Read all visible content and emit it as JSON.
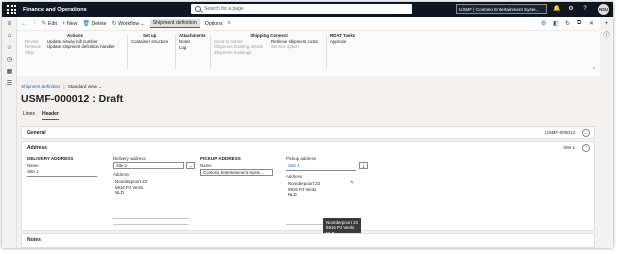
{
  "topbar": {
    "app_title": "Finance and Operations",
    "search_placeholder": "Search for a page",
    "company": "USMF | Contoso Entertainment Syste...",
    "user_initials": "NSU"
  },
  "action_pane": {
    "commands": {
      "edit": "Edit",
      "new": "New",
      "delete": "Delete",
      "workflow": "Workflow",
      "shipment_definition_tab": "Shipment definition",
      "options": "Options"
    },
    "groups": {
      "actions": {
        "title": "Actions",
        "left_items": [
          "Revise",
          "Release",
          "Ship"
        ],
        "right_items": [
          "Update airway bill number",
          "Update shipment definition handler"
        ]
      },
      "setup": {
        "title": "Set up",
        "items": [
          "Container structure"
        ]
      },
      "attachments": {
        "title": "Attachments",
        "items": [
          "Notes",
          "Log"
        ]
      },
      "shipping_connect": {
        "title": "Shipping Connect",
        "left_items": [
          "Send to carrier",
          "Shipment booking details",
          "Shipment bookings"
        ],
        "right_items": [
          "Retrieve shipment costs",
          "Service option"
        ]
      },
      "rdat_tasks": {
        "title": "RDAT Tasks",
        "items": [
          "Approve"
        ]
      }
    }
  },
  "page": {
    "breadcrumb": {
      "link": "Shipment definition",
      "separator": "|",
      "view": "Standard view"
    },
    "title": "USMF-000012 : Draft",
    "tabs": {
      "lines": "Lines",
      "header": "Header"
    }
  },
  "general": {
    "title": "General",
    "summary": "USMF-000012"
  },
  "address_section": {
    "title": "Address",
    "summary": "Site 1",
    "delivery": {
      "group_title": "DELIVERY ADDRESS",
      "name_label": "Name",
      "name_value": "Site 1",
      "delivery_address_label": "Delivery address",
      "delivery_address_value": "Site 1",
      "address_label": "Address",
      "address_lines": [
        "Noorderpoort 23",
        "5916 PJ Venlo",
        "NLD"
      ]
    },
    "pickup": {
      "group_title": "PICKUP ADDRESS",
      "name_label": "Name",
      "name_value": "Contoso Entertainment Syste...",
      "pickup_address_label": "Pickup address",
      "pickup_address_value": "Site 1",
      "address_label": "Address",
      "address_lines": [
        "Noorderpoort 23",
        "5916 PJ Venlo",
        "NLD"
      ]
    },
    "tooltip_lines": [
      "Noorderpoort 23",
      "5916 PJ Venlo",
      "NLD"
    ]
  },
  "notes": {
    "title": "Notes"
  },
  "colors": {
    "accent": "#0f6cbd",
    "topbar": "#0e1621"
  }
}
